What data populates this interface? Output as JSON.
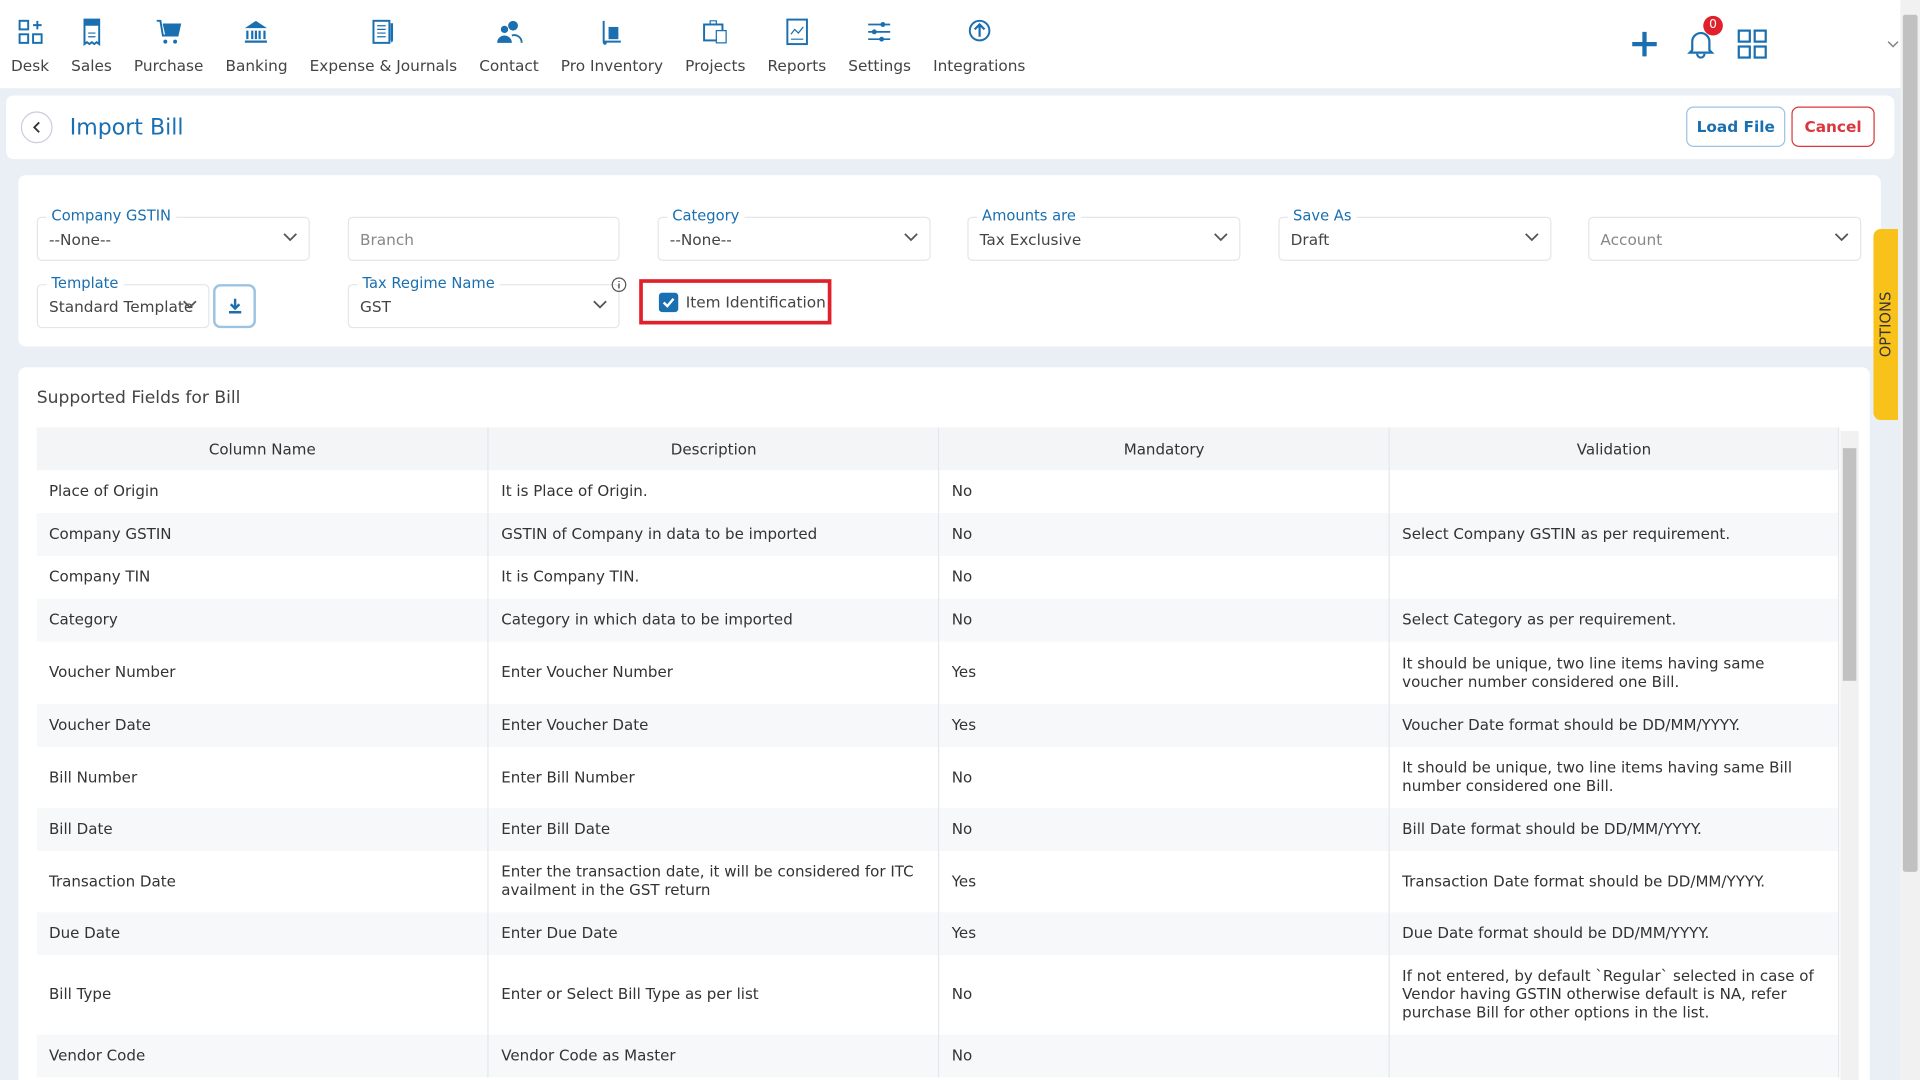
{
  "nav": {
    "items": [
      {
        "label": "Desk",
        "icon": "desk-icon"
      },
      {
        "label": "Sales",
        "icon": "receipt-icon"
      },
      {
        "label": "Purchase",
        "icon": "cart-icon"
      },
      {
        "label": "Banking",
        "icon": "bank-icon"
      },
      {
        "label": "Expense & Journals",
        "icon": "journal-icon"
      },
      {
        "label": "Contact",
        "icon": "contacts-icon"
      },
      {
        "label": "Pro Inventory",
        "icon": "inventory-icon"
      },
      {
        "label": "Projects",
        "icon": "projects-icon"
      },
      {
        "label": "Reports",
        "icon": "reports-icon"
      },
      {
        "label": "Settings",
        "icon": "sliders-icon"
      },
      {
        "label": "Integrations",
        "icon": "integrations-icon"
      }
    ],
    "notification_count": "0"
  },
  "header": {
    "title": "Import Bill",
    "load_file": "Load File",
    "cancel": "Cancel"
  },
  "filters": {
    "company_gstin": {
      "label": "Company GSTIN",
      "value": "--None--"
    },
    "branch": {
      "placeholder": "Branch"
    },
    "category": {
      "label": "Category",
      "value": "--None--"
    },
    "amounts_are": {
      "label": "Amounts are",
      "value": "Tax Exclusive"
    },
    "save_as": {
      "label": "Save As",
      "value": "Draft"
    },
    "account": {
      "placeholder": "Account"
    },
    "template": {
      "label": "Template",
      "value": "Standard Template"
    },
    "tax_regime": {
      "label": "Tax Regime Name",
      "value": "GST"
    },
    "item_identification": {
      "label": "Item Identification",
      "checked": true
    }
  },
  "options_tab": "OPTIONS",
  "table": {
    "title": "Supported Fields for Bill",
    "headers": [
      "Column Name",
      "Description",
      "Mandatory",
      "Validation"
    ],
    "rows": [
      [
        "Place of Origin",
        "It is Place of Origin.",
        "No",
        ""
      ],
      [
        "Company GSTIN",
        "GSTIN of Company in data to be imported",
        "No",
        "Select Company GSTIN as per requirement."
      ],
      [
        "Company TIN",
        "It is Company TIN.",
        "No",
        ""
      ],
      [
        "Category",
        "Category in which data to be imported",
        "No",
        "Select Category as per requirement."
      ],
      [
        "Voucher Number",
        "Enter Voucher Number",
        "Yes",
        "It should be unique, two line items having same voucher number considered one Bill."
      ],
      [
        "Voucher Date",
        "Enter Voucher Date",
        "Yes",
        "Voucher Date format should be DD/MM/YYYY."
      ],
      [
        "Bill Number",
        "Enter Bill Number",
        "No",
        "It should be unique, two line items having same Bill number considered one Bill."
      ],
      [
        "Bill Date",
        "Enter Bill Date",
        "No",
        "Bill Date format should be DD/MM/YYYY."
      ],
      [
        "Transaction Date",
        "Enter the transaction date, it will be considered for ITC availment in the GST return",
        "Yes",
        "Transaction Date format should be DD/MM/YYYY."
      ],
      [
        "Due Date",
        "Enter Due Date",
        "Yes",
        "Due Date format should be DD/MM/YYYY."
      ],
      [
        "Bill Type",
        "Enter or Select Bill Type as per list",
        "No",
        "If not entered, by default `Regular` selected in case of Vendor having GSTIN otherwise default is NA, refer purchase Bill for other options in the list."
      ],
      [
        "Vendor Code",
        "Vendor Code as Master",
        "No",
        ""
      ]
    ]
  },
  "colors": {
    "accent": "#1a6fb0",
    "cancel": "#d9363e",
    "highlight": "#e0202a",
    "options": "#f9c21b"
  }
}
